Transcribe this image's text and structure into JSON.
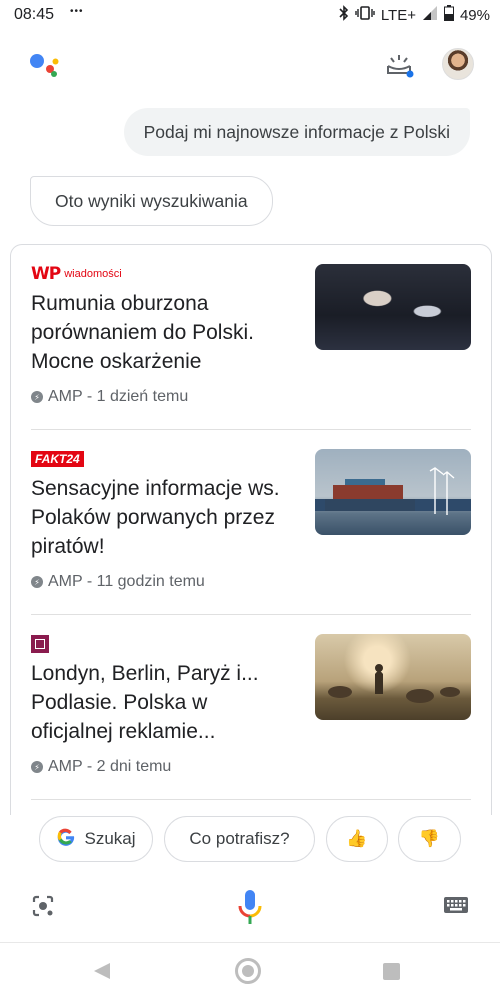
{
  "status_bar": {
    "time": "08:45",
    "notification_dots": "•••",
    "network": "LTE+",
    "battery": "49%"
  },
  "conversation": {
    "user_query": "Podaj mi najnowsze informacje z Polski",
    "assistant_reply": "Oto wyniki wyszukiwania"
  },
  "news": [
    {
      "source": "wiadomości",
      "source_mark": "WP",
      "headline": "Rumunia oburzona porównaniem do Polski. Mocne oskarżenie",
      "meta": "AMP - 1 dzień temu",
      "thumb_icon": "news-photo"
    },
    {
      "source": "FAKT24",
      "headline": "Sensacyjne informacje ws. Polaków porwanych przez piratów!",
      "meta": "AMP - 11 godzin temu",
      "thumb_icon": "news-photo"
    },
    {
      "source_mark": "◻",
      "headline": "Londyn, Berlin, Paryż i... Podlasie. Polska w oficjalnej reklamie...",
      "meta": "AMP - 2 dni temu",
      "thumb_icon": "news-photo"
    }
  ],
  "chips": {
    "search_label": "Szukaj",
    "help_label": "Co potrafisz?",
    "thumbs_up": "👍",
    "thumbs_down": "👎"
  },
  "colors": {
    "google_blue": "#4285f4",
    "google_red": "#ea4335",
    "google_yellow": "#fbbc05",
    "google_green": "#34a853",
    "fakt_red": "#e30613",
    "chip_border": "#dadce0"
  }
}
